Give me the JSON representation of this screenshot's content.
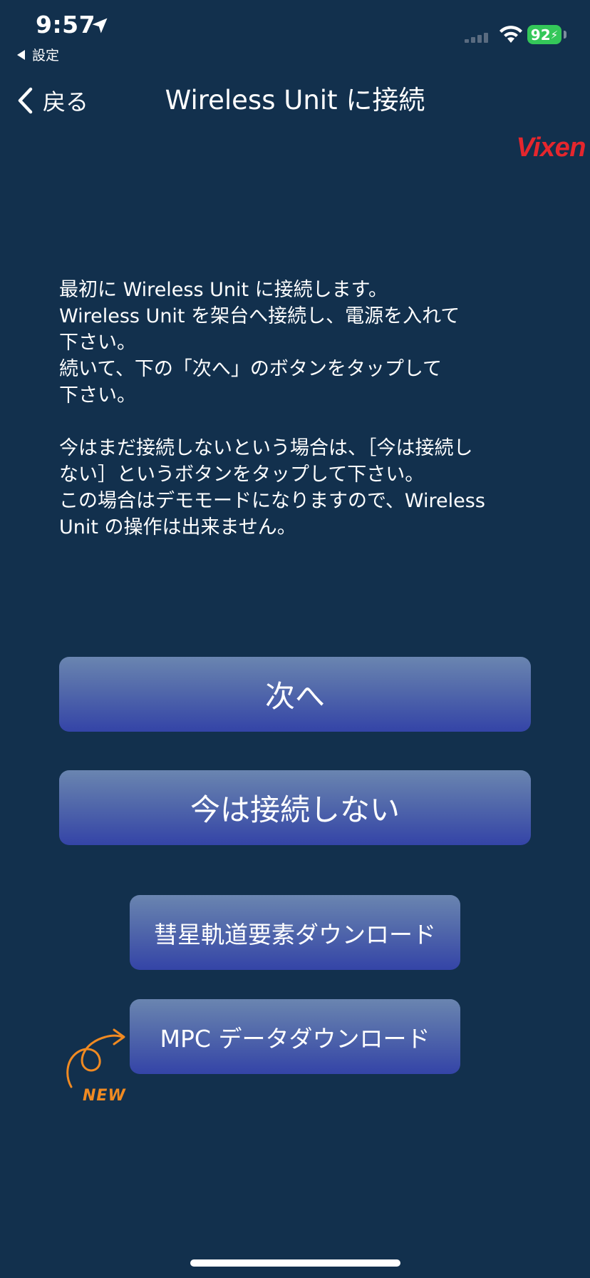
{
  "status_bar": {
    "time": "9:57",
    "back_to_app": "設定",
    "battery": "92"
  },
  "nav": {
    "back_label": "戻る",
    "title": "Wireless Unit に接続"
  },
  "brand": {
    "logo_text": "Vixen",
    "color": "#e5262d"
  },
  "instructions": "最初に Wireless Unit に接続します。\nWireless Unit を架台へ接続し、電源を入れて\n下さい。\n続いて、下の「次へ」のボタンをタップして\n下さい。\n\n今はまだ接続しないという場合は、［今は接続し\nない］というボタンをタップして下さい。\nこの場合はデモモードになりますので、Wireless\nUnit の操作は出来ません。",
  "buttons": {
    "next": "次へ",
    "skip": "今は接続しない",
    "comet_download": "彗星軌道要素ダウンロード",
    "mpc_download": "MPC データダウンロード"
  },
  "badge": {
    "new_label": "NEW",
    "color": "#f08a22"
  },
  "colors": {
    "background": "#12304d",
    "battery": "#34c759"
  }
}
